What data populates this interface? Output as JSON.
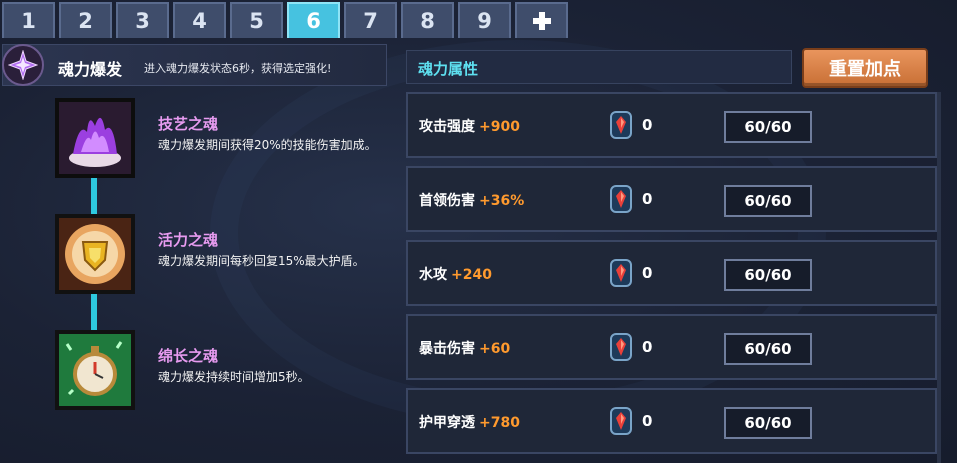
{
  "tabs": [
    "1",
    "2",
    "3",
    "4",
    "5",
    "6",
    "7",
    "8",
    "9"
  ],
  "active_tab": "6",
  "add_tab_icon": "plus-icon",
  "soul_burst": {
    "title": "魂力爆发",
    "description": "进入魂力爆发状态6秒，获得选定强化!"
  },
  "souls": [
    {
      "name": "技艺之魂",
      "description": "魂力爆发期间获得20%的技能伤害加成。",
      "icon": "purple-flame-icon"
    },
    {
      "name": "活力之魂",
      "description": "魂力爆发期间每秒回复15%最大护盾。",
      "icon": "golden-shield-icon"
    },
    {
      "name": "绵长之魂",
      "description": "魂力爆发持续时间增加5秒。",
      "icon": "stopwatch-icon"
    }
  ],
  "attributes": {
    "title": "魂力属性",
    "reset_label": "重置加点",
    "rows": [
      {
        "label": "攻击强度",
        "bonus": "+900",
        "count": "0",
        "value": "60/60"
      },
      {
        "label": "首领伤害",
        "bonus": "+36%",
        "count": "0",
        "value": "60/60"
      },
      {
        "label": "水攻",
        "bonus": "+240",
        "count": "0",
        "value": "60/60"
      },
      {
        "label": "暴击伤害",
        "bonus": "+60",
        "count": "0",
        "value": "60/60"
      },
      {
        "label": "护甲穿透",
        "bonus": "+780",
        "count": "0",
        "value": "60/60"
      }
    ]
  },
  "colors": {
    "accent": "#46c2e0",
    "bonus": "#ff9a2e",
    "soul_name": "#e79bf0",
    "reset": "#d98048"
  }
}
